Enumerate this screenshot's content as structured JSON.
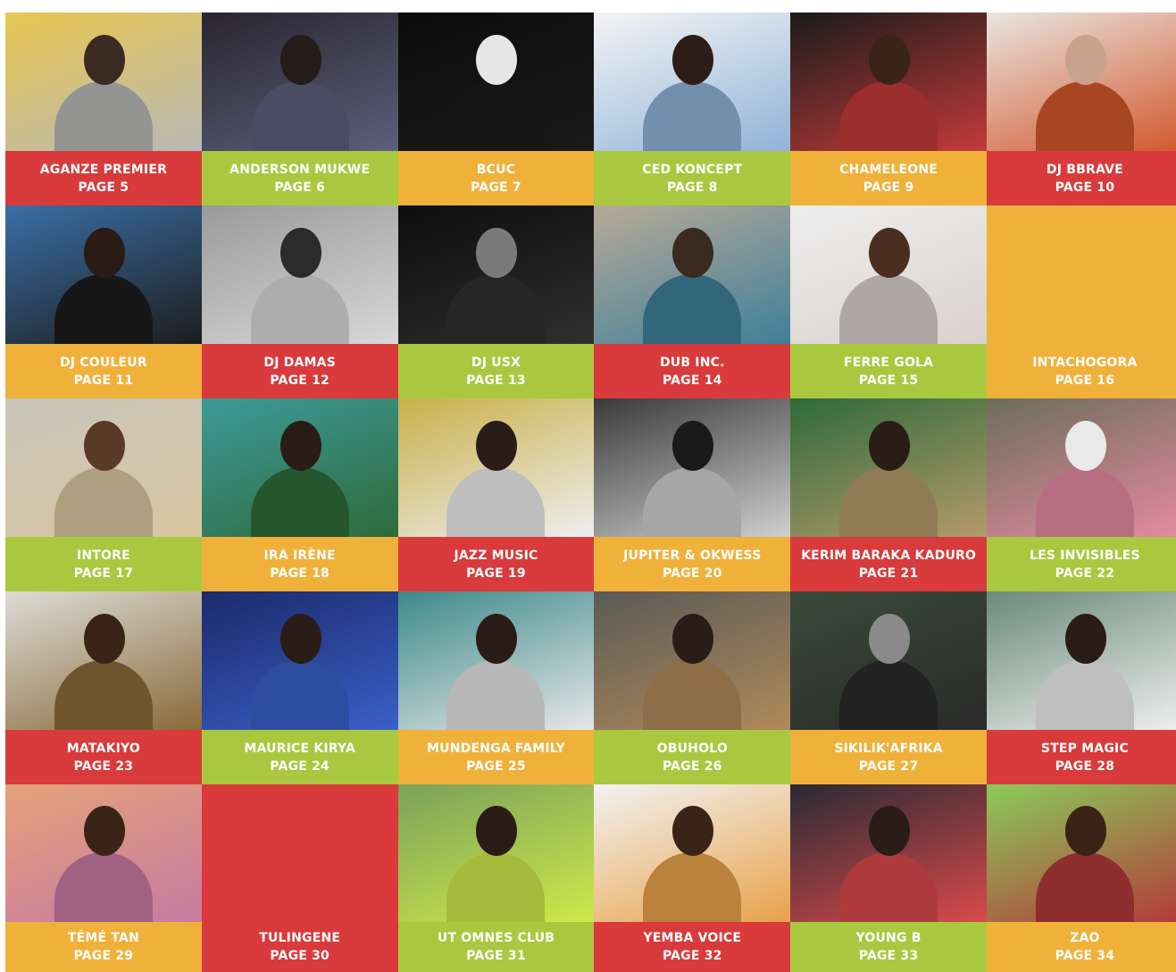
{
  "colors": {
    "red": "#d93a3b",
    "green": "#a9c83f",
    "orange": "#f0b13a",
    "orange_light": "#f3c15a",
    "red_light": "#e05a5b"
  },
  "artists": [
    {
      "name": "AGANZE PREMIER",
      "page": "PAGE 5",
      "color": "#d93a3b",
      "photo": [
        "#e8c650",
        "#3b2a22",
        "#b9b9b6"
      ]
    },
    {
      "name": "ANDERSON MUKWE",
      "page": "PAGE 6",
      "color": "#a9c83f",
      "photo": [
        "#2a2630",
        "#241c18",
        "#5b5f7a"
      ]
    },
    {
      "name": "BCUC",
      "page": "PAGE 7",
      "color": "#f0b13a",
      "photo": [
        "#0c0c0c",
        "#e6e6e6",
        "#1a1a1a"
      ]
    },
    {
      "name": "CED KONCEPT",
      "page": "PAGE 8",
      "color": "#a9c83f",
      "photo": [
        "#f4f4f4",
        "#2e1d16",
        "#8fb3d8"
      ]
    },
    {
      "name": "CHAMELEONE",
      "page": "PAGE 9",
      "color": "#f0b13a",
      "photo": [
        "#1b1b1b",
        "#3a2418",
        "#c43a3a"
      ]
    },
    {
      "name": "DJ BBRAVE",
      "page": "PAGE 10",
      "color": "#d93a3b",
      "photo": [
        "#e9e5e0",
        "#c8a28a",
        "#d2582d"
      ]
    },
    {
      "name": "DJ COULEUR",
      "page": "PAGE 11",
      "color": "#f0b13a",
      "photo": [
        "#3a6fa6",
        "#2a1b14",
        "#1d1d1d"
      ]
    },
    {
      "name": "DJ DAMAS",
      "page": "PAGE 12",
      "color": "#d93a3b",
      "photo": [
        "#9a9a9a",
        "#2b2b2b",
        "#d8d8d8"
      ]
    },
    {
      "name": "DJ USX",
      "page": "PAGE 13",
      "color": "#a9c83f",
      "photo": [
        "#0d0d0d",
        "#7a7a7a",
        "#2f2f2f"
      ]
    },
    {
      "name": "DUB INC.",
      "page": "PAGE 14",
      "color": "#d93a3b",
      "photo": [
        "#b7aa98",
        "#3a2a20",
        "#3f7f9a"
      ]
    },
    {
      "name": "FERRE GOLA",
      "page": "PAGE 15",
      "color": "#a9c83f",
      "photo": [
        "#eeeeee",
        "#4a2e20",
        "#d8d2cc"
      ]
    },
    {
      "name": "INTACHOGORA",
      "page": "PAGE 16",
      "color": "#f0b13a",
      "photo": null
    },
    {
      "name": "INTORE",
      "page": "PAGE 17",
      "color": "#a9c83f",
      "photo": [
        "#c9c4ba",
        "#5a3a26",
        "#d9c7a0"
      ]
    },
    {
      "name": "IRA IRÈNE",
      "page": "PAGE 18",
      "color": "#f0b13a",
      "photo": [
        "#3d9a9a",
        "#2a1d18",
        "#2e6b3a"
      ]
    },
    {
      "name": "JAZZ MUSIC",
      "page": "PAGE 19",
      "color": "#d93a3b",
      "photo": [
        "#c9b04a",
        "#2a1d18",
        "#eeeeee"
      ]
    },
    {
      "name": "JUPITER & OKWESS",
      "page": "PAGE 20",
      "color": "#f0b13a",
      "photo": [
        "#3a3a3a",
        "#1a1a1a",
        "#cfcfcf"
      ]
    },
    {
      "name": "KERIM BARAKA KADURO",
      "page": "PAGE 21",
      "color": "#d93a3b",
      "photo": [
        "#2f6a3a",
        "#2a1d18",
        "#b49a6a"
      ]
    },
    {
      "name": "LES INVISIBLES",
      "page": "PAGE 22",
      "color": "#a9c83f",
      "photo": [
        "#6c6e5c",
        "#e9e9e9",
        "#e58aa0"
      ]
    },
    {
      "name": "MATAKIYO",
      "page": "PAGE 23",
      "color": "#d93a3b",
      "photo": [
        "#dcdcd6",
        "#3a2418",
        "#8a6a3a"
      ]
    },
    {
      "name": "MAURICE KIRYA",
      "page": "PAGE 24",
      "color": "#a9c83f",
      "photo": [
        "#1b2a6b",
        "#2a1d18",
        "#3a60c8"
      ]
    },
    {
      "name": "MUNDENGA FAMILY",
      "page": "PAGE 25",
      "color": "#f0b13a",
      "photo": [
        "#3d8a8a",
        "#2a1d18",
        "#e6e6e6"
      ]
    },
    {
      "name": "OBUHOLO",
      "page": "PAGE 26",
      "color": "#a9c83f",
      "photo": [
        "#5a5a56",
        "#2a1d18",
        "#b08a5a"
      ]
    },
    {
      "name": "SIKILIK'AFRIKA",
      "page": "PAGE 27",
      "color": "#f0b13a",
      "photo": [
        "#3a4a3a",
        "#8a8a8a",
        "#2a2a2a"
      ]
    },
    {
      "name": "STEP MAGIC",
      "page": "PAGE 28",
      "color": "#d93a3b",
      "photo": [
        "#6a8a7a",
        "#2a1d18",
        "#efefef"
      ]
    },
    {
      "name": "TÉMÉ TAN",
      "page": "PAGE 29",
      "color": "#f0b13a",
      "photo": [
        "#e4a27a",
        "#3a2418",
        "#c77aa2"
      ]
    },
    {
      "name": "TULINGENE",
      "page": "PAGE 30",
      "color": "#d93a3b",
      "photo": null
    },
    {
      "name": "UT OMNES CLUB",
      "page": "PAGE 31",
      "color": "#a9c83f",
      "photo": [
        "#7aa25a",
        "#2a1d18",
        "#cfe84a"
      ]
    },
    {
      "name": "YEMBA VOICE",
      "page": "PAGE 32",
      "color": "#d93a3b",
      "photo": [
        "#f2f2f2",
        "#3a2418",
        "#e8a24a"
      ]
    },
    {
      "name": "YOUNG B",
      "page": "PAGE 33",
      "color": "#a9c83f",
      "photo": [
        "#2a2a34",
        "#2a1d18",
        "#d94a4a"
      ]
    },
    {
      "name": "ZAO",
      "page": "PAGE 34",
      "color": "#f0b13a",
      "photo": [
        "#8acb5a",
        "#3a2418",
        "#b33a3a"
      ]
    }
  ]
}
